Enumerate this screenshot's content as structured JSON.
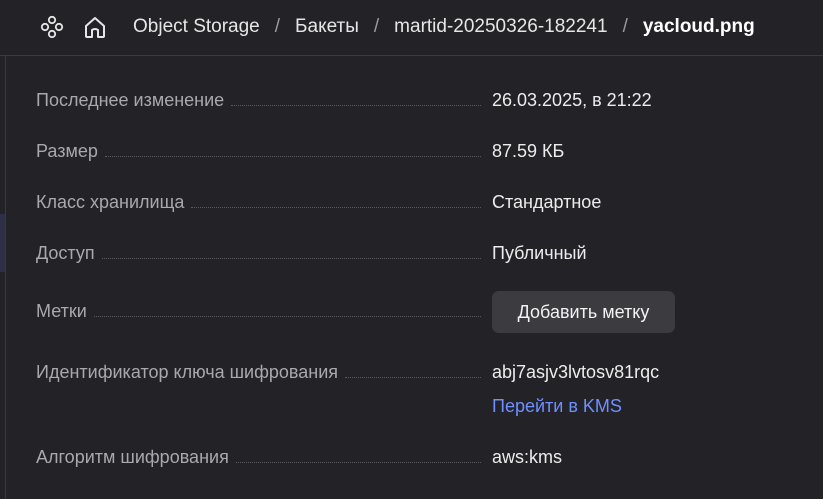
{
  "header": {
    "logo_icon": "cloud-services-icon",
    "home_icon": "home-icon",
    "breadcrumb": [
      {
        "label": "Object Storage"
      },
      {
        "label": "Бакеты"
      },
      {
        "label": "martid-20250326-182241"
      },
      {
        "label": "yacloud.png"
      }
    ],
    "separator": "/"
  },
  "details": {
    "last_modified": {
      "label": "Последнее изменение",
      "value": "26.03.2025, в 21:22"
    },
    "size": {
      "label": "Размер",
      "value": "87.59 КБ"
    },
    "storage_class": {
      "label": "Класс хранилища",
      "value": "Стандартное"
    },
    "access": {
      "label": "Доступ",
      "value": "Публичный"
    },
    "tags": {
      "label": "Метки",
      "button": "Добавить метку"
    },
    "encryption_key": {
      "label": "Идентификатор ключа шифрования",
      "value": "abj7asjv3lvtosv81rqc",
      "link": "Перейти в KMS"
    },
    "encryption_algorithm": {
      "label": "Алгоритм шифрования",
      "value": "aws:kms"
    }
  },
  "colors": {
    "background": "#232327",
    "label": "#a9a9ad",
    "value": "#ececec",
    "link": "#6f8fff",
    "button_bg": "#3b3b40"
  }
}
